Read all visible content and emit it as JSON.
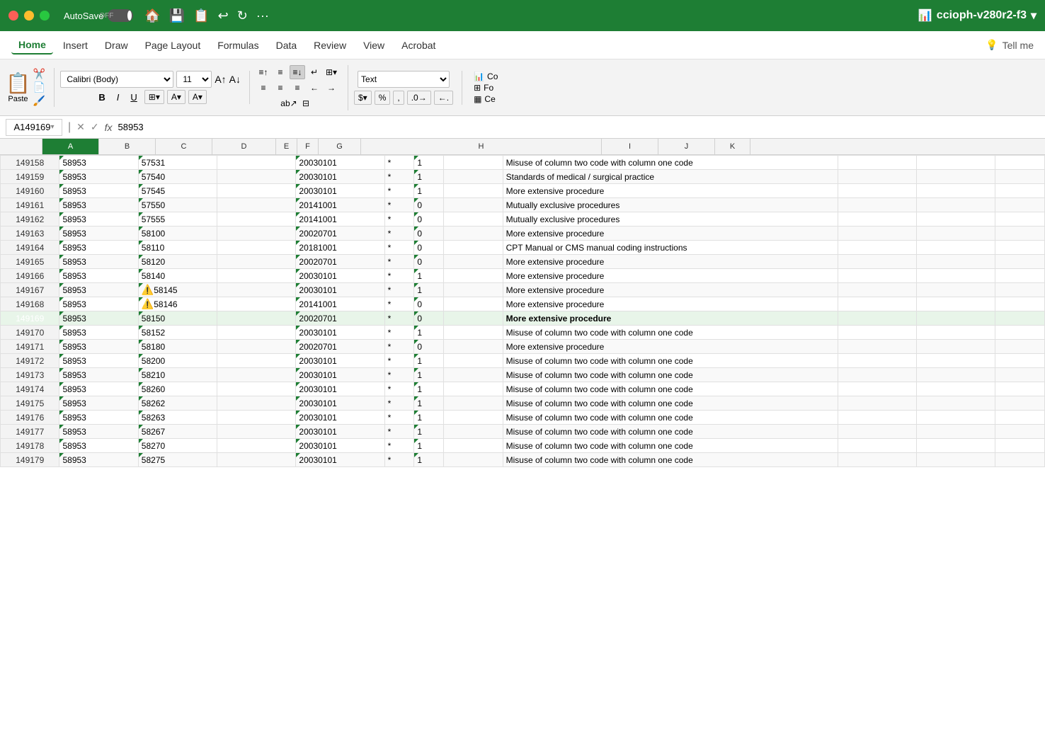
{
  "titleBar": {
    "autosave": "AutoSave",
    "off": "OFF",
    "filename": "ccioph-v280r2-f3"
  },
  "menuBar": {
    "items": [
      "Home",
      "Insert",
      "Draw",
      "Page Layout",
      "Formulas",
      "Data",
      "Review",
      "View",
      "Acrobat"
    ],
    "tellme": "Tell me",
    "activeItem": "Home"
  },
  "ribbon": {
    "pasteLabel": "Paste",
    "fontName": "Calibri (Body)",
    "fontSize": "11",
    "bold": "B",
    "italic": "I",
    "underline": "U",
    "numberFormat": "Text",
    "dollarSign": "$",
    "percent": "%",
    "comma": ",",
    "decIncrease": ".00→",
    "decDecrease": "←.0"
  },
  "formulaBar": {
    "cellRef": "A149169",
    "formula": "58953"
  },
  "columns": {
    "headers": [
      "A",
      "B",
      "C",
      "D",
      "E",
      "F",
      "G",
      "H",
      "I",
      "J",
      "K"
    ]
  },
  "rows": [
    {
      "num": "149158",
      "a": "58953",
      "b": "57531",
      "c": "",
      "d": "20030101",
      "e": "*",
      "f": "1",
      "g": "",
      "h": "Misuse of column two code with column one code",
      "i": "",
      "j": "",
      "k": ""
    },
    {
      "num": "149159",
      "a": "58953",
      "b": "57540",
      "c": "",
      "d": "20030101",
      "e": "*",
      "f": "1",
      "g": "",
      "h": "Standards of medical / surgical practice",
      "i": "",
      "j": "",
      "k": ""
    },
    {
      "num": "149160",
      "a": "58953",
      "b": "57545",
      "c": "",
      "d": "20030101",
      "e": "*",
      "f": "1",
      "g": "",
      "h": "More extensive procedure",
      "i": "",
      "j": "",
      "k": ""
    },
    {
      "num": "149161",
      "a": "58953",
      "b": "57550",
      "c": "",
      "d": "20141001",
      "e": "*",
      "f": "0",
      "g": "",
      "h": "Mutually exclusive procedures",
      "i": "",
      "j": "",
      "k": ""
    },
    {
      "num": "149162",
      "a": "58953",
      "b": "57555",
      "c": "",
      "d": "20141001",
      "e": "*",
      "f": "0",
      "g": "",
      "h": "Mutually exclusive procedures",
      "i": "",
      "j": "",
      "k": ""
    },
    {
      "num": "149163",
      "a": "58953",
      "b": "58100",
      "c": "",
      "d": "20020701",
      "e": "*",
      "f": "0",
      "g": "",
      "h": "More extensive procedure",
      "i": "",
      "j": "",
      "k": ""
    },
    {
      "num": "149164",
      "a": "58953",
      "b": "58110",
      "c": "",
      "d": "20181001",
      "e": "*",
      "f": "0",
      "g": "",
      "h": "CPT Manual or CMS manual coding instructions",
      "i": "",
      "j": "",
      "k": ""
    },
    {
      "num": "149165",
      "a": "58953",
      "b": "58120",
      "c": "",
      "d": "20020701",
      "e": "*",
      "f": "0",
      "g": "",
      "h": "More extensive procedure",
      "i": "",
      "j": "",
      "k": ""
    },
    {
      "num": "149166",
      "a": "58953",
      "b": "58140",
      "c": "",
      "d": "20030101",
      "e": "*",
      "f": "1",
      "g": "",
      "h": "More extensive procedure",
      "i": "",
      "j": "",
      "k": ""
    },
    {
      "num": "149167",
      "a": "58953",
      "b": "58145",
      "c": "",
      "d": "20030101",
      "e": "*",
      "f": "1",
      "g": "",
      "h": "More extensive procedure",
      "i": "",
      "j": "",
      "k": "",
      "warning": true
    },
    {
      "num": "149168",
      "a": "58953",
      "b": "58146",
      "c": "",
      "d": "20141001",
      "e": "*",
      "f": "0",
      "g": "",
      "h": "More extensive procedure",
      "i": "",
      "j": "",
      "k": "",
      "warning": true
    },
    {
      "num": "149169",
      "a": "58953",
      "b": "58150",
      "c": "",
      "d": "20020701",
      "e": "*",
      "f": "0",
      "g": "",
      "h": "More extensive procedure",
      "i": "",
      "j": "",
      "k": "",
      "selected": true
    },
    {
      "num": "149170",
      "a": "58953",
      "b": "58152",
      "c": "",
      "d": "20030101",
      "e": "*",
      "f": "1",
      "g": "",
      "h": "Misuse of column two code with column one code",
      "i": "",
      "j": "",
      "k": ""
    },
    {
      "num": "149171",
      "a": "58953",
      "b": "58180",
      "c": "",
      "d": "20020701",
      "e": "*",
      "f": "0",
      "g": "",
      "h": "More extensive procedure",
      "i": "",
      "j": "",
      "k": ""
    },
    {
      "num": "149172",
      "a": "58953",
      "b": "58200",
      "c": "",
      "d": "20030101",
      "e": "*",
      "f": "1",
      "g": "",
      "h": "Misuse of column two code with column one code",
      "i": "",
      "j": "",
      "k": ""
    },
    {
      "num": "149173",
      "a": "58953",
      "b": "58210",
      "c": "",
      "d": "20030101",
      "e": "*",
      "f": "1",
      "g": "",
      "h": "Misuse of column two code with column one code",
      "i": "",
      "j": "",
      "k": ""
    },
    {
      "num": "149174",
      "a": "58953",
      "b": "58260",
      "c": "",
      "d": "20030101",
      "e": "*",
      "f": "1",
      "g": "",
      "h": "Misuse of column two code with column one code",
      "i": "",
      "j": "",
      "k": ""
    },
    {
      "num": "149175",
      "a": "58953",
      "b": "58262",
      "c": "",
      "d": "20030101",
      "e": "*",
      "f": "1",
      "g": "",
      "h": "Misuse of column two code with column one code",
      "i": "",
      "j": "",
      "k": ""
    },
    {
      "num": "149176",
      "a": "58953",
      "b": "58263",
      "c": "",
      "d": "20030101",
      "e": "*",
      "f": "1",
      "g": "",
      "h": "Misuse of column two code with column one code",
      "i": "",
      "j": "",
      "k": ""
    },
    {
      "num": "149177",
      "a": "58953",
      "b": "58267",
      "c": "",
      "d": "20030101",
      "e": "*",
      "f": "1",
      "g": "",
      "h": "Misuse of column two code with column one code",
      "i": "",
      "j": "",
      "k": ""
    },
    {
      "num": "149178",
      "a": "58953",
      "b": "58270",
      "c": "",
      "d": "20030101",
      "e": "*",
      "f": "1",
      "g": "",
      "h": "Misuse of column two code with column one code",
      "i": "",
      "j": "",
      "k": ""
    },
    {
      "num": "149179",
      "a": "58953",
      "b": "58275",
      "c": "",
      "d": "20030101",
      "e": "*",
      "f": "1",
      "g": "",
      "h": "Misuse of column two code with column one code",
      "i": "",
      "j": "",
      "k": ""
    }
  ]
}
